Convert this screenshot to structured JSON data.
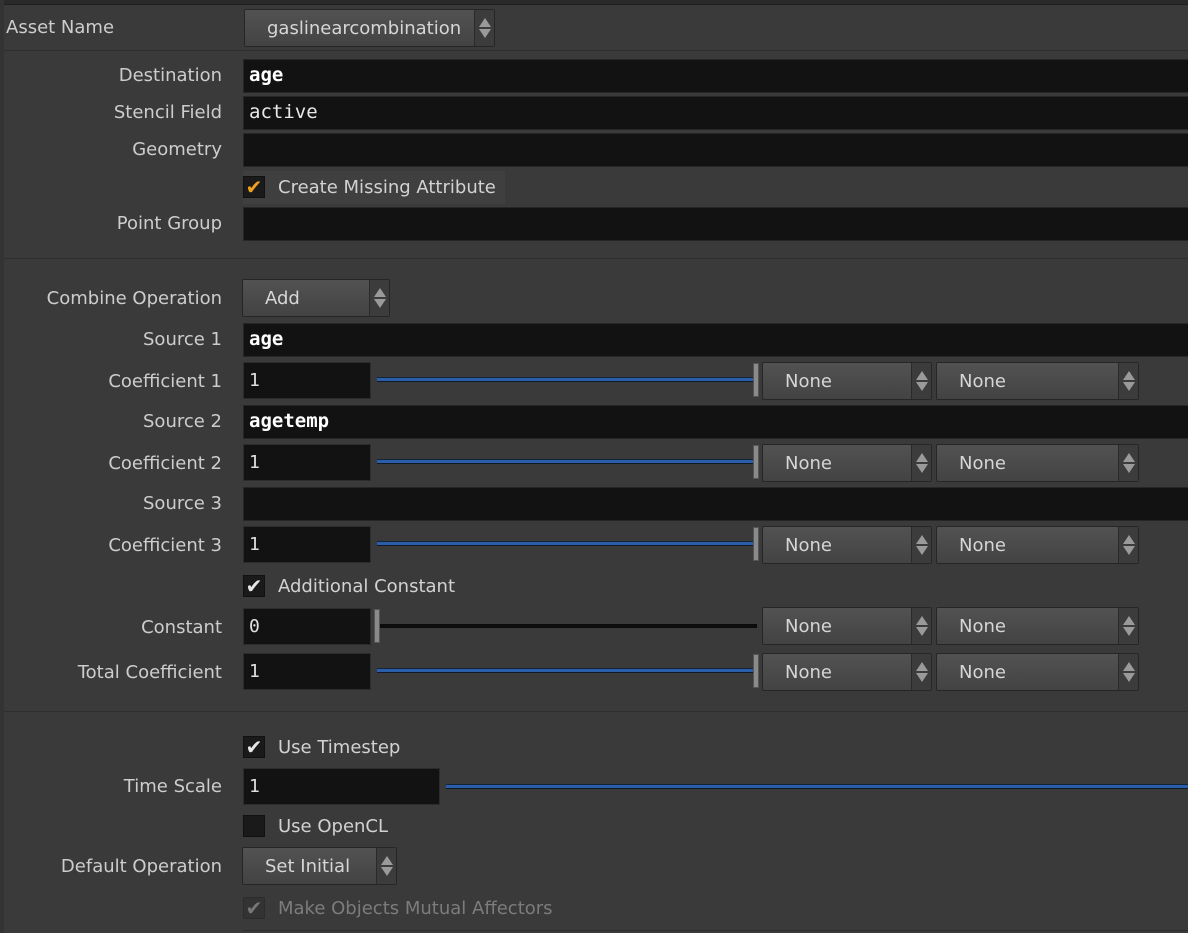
{
  "asset": {
    "label": "Asset Name",
    "value": "gaslinearcombination"
  },
  "fields": {
    "destination": {
      "label": "Destination",
      "value": "age"
    },
    "stencil": {
      "label": "Stencil Field",
      "value": "active"
    },
    "geometry": {
      "label": "Geometry",
      "value": ""
    },
    "create_missing": {
      "label": "Create Missing Attribute",
      "checked": true
    },
    "point_group": {
      "label": "Point Group",
      "value": ""
    }
  },
  "combine": {
    "label": "Combine Operation",
    "value": "Add"
  },
  "sources": [
    {
      "label": "Source 1",
      "value": "age",
      "coef_label": "Coefficient 1",
      "coef": "1",
      "menu1": "None",
      "menu2": "None"
    },
    {
      "label": "Source 2",
      "value": "agetemp",
      "coef_label": "Coefficient 2",
      "coef": "1",
      "menu1": "None",
      "menu2": "None"
    },
    {
      "label": "Source 3",
      "value": "",
      "coef_label": "Coefficient 3",
      "coef": "1",
      "menu1": "None",
      "menu2": "None"
    }
  ],
  "additional_constant": {
    "label": "Additional Constant",
    "checked": true
  },
  "constant": {
    "label": "Constant",
    "value": "0",
    "menu1": "None",
    "menu2": "None"
  },
  "total_coefficient": {
    "label": "Total Coefficient",
    "value": "1",
    "menu1": "None",
    "menu2": "None"
  },
  "use_timestep": {
    "label": "Use Timestep",
    "checked": true
  },
  "time_scale": {
    "label": "Time Scale",
    "value": "1"
  },
  "use_opencl": {
    "label": "Use OpenCL",
    "checked": false
  },
  "default_operation": {
    "label": "Default Operation",
    "value": "Set Initial"
  },
  "mutual_affectors": {
    "label": "Make Objects Mutual Affectors",
    "checked": true,
    "disabled": true
  },
  "icons": {
    "check": "checkmark-icon",
    "spinner": "up-down-arrows-icon"
  },
  "colors": {
    "slider": "#2b5ea8",
    "check_orange": "#f0a020",
    "field_bg": "#121212",
    "panel_bg": "#3a3a3a"
  }
}
